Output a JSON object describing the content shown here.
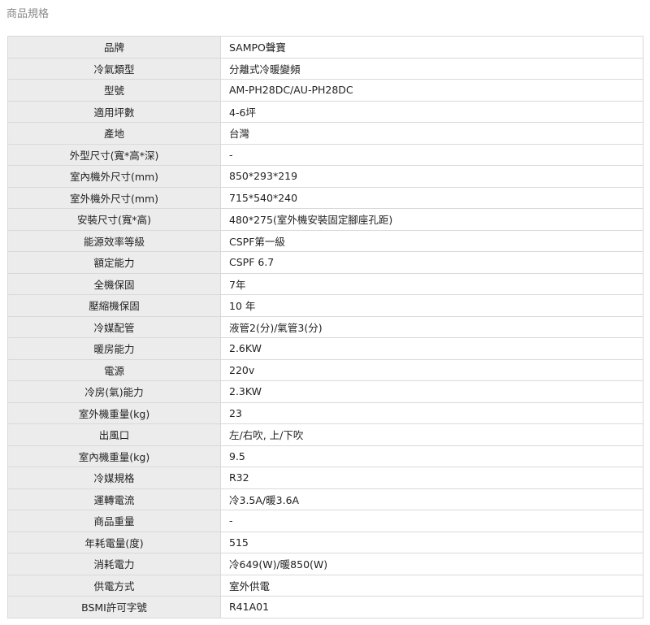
{
  "section": {
    "title": "商品規格"
  },
  "specs": [
    {
      "label": "品牌",
      "value": "SAMPO聲寶"
    },
    {
      "label": "冷氣類型",
      "value": "分離式冷暖變頻"
    },
    {
      "label": "型號",
      "value": "AM-PH28DC/AU-PH28DC"
    },
    {
      "label": "適用坪數",
      "value": "4-6坪"
    },
    {
      "label": "產地",
      "value": "台灣"
    },
    {
      "label": "外型尺寸(寬*高*深)",
      "value": "-"
    },
    {
      "label": "室內機外尺寸(mm)",
      "value": "850*293*219"
    },
    {
      "label": "室外機外尺寸(mm)",
      "value": "715*540*240"
    },
    {
      "label": "安裝尺寸(寬*高)",
      "value": "480*275(室外機安裝固定腳座孔距)"
    },
    {
      "label": "能源效率等級",
      "value": "CSPF第一級"
    },
    {
      "label": "額定能力",
      "value": "CSPF 6.7"
    },
    {
      "label": "全機保固",
      "value": "7年"
    },
    {
      "label": "壓縮機保固",
      "value": "10 年"
    },
    {
      "label": "冷媒配管",
      "value": "液管2(分)/氣管3(分)"
    },
    {
      "label": "暖房能力",
      "value": "2.6KW"
    },
    {
      "label": "電源",
      "value": "220v"
    },
    {
      "label": "冷房(氣)能力",
      "value": "2.3KW"
    },
    {
      "label": "室外機重量(kg)",
      "value": "23"
    },
    {
      "label": "出風口",
      "value": "左/右吹, 上/下吹"
    },
    {
      "label": "室內機重量(kg)",
      "value": "9.5"
    },
    {
      "label": "冷媒規格",
      "value": "R32"
    },
    {
      "label": "運轉電流",
      "value": "冷3.5A/暖3.6A"
    },
    {
      "label": "商品重量",
      "value": "-"
    },
    {
      "label": "年耗電量(度)",
      "value": "515"
    },
    {
      "label": "消耗電力",
      "value": "冷649(W)/暖850(W)"
    },
    {
      "label": "供電方式",
      "value": "室外供電"
    },
    {
      "label": "BSMI許可字號",
      "value": "R41A01"
    }
  ]
}
